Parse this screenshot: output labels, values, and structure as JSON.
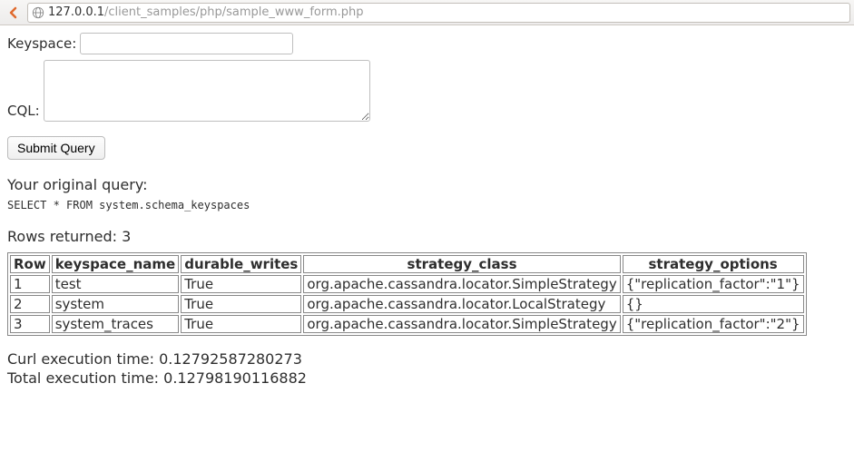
{
  "url": {
    "host": "127.0.0.1",
    "path": "/client_samples/php/sample_www_form.php"
  },
  "form": {
    "keyspace_label": "Keyspace:",
    "keyspace_value": "",
    "cql_label": "CQL:",
    "cql_value": "",
    "submit_label": "Submit Query"
  },
  "original_query_label": "Your original query:",
  "original_query": "SELECT * FROM system.schema_keyspaces",
  "rows_returned_label": "Rows returned: ",
  "rows_returned_count": "3",
  "table": {
    "headers": [
      "Row",
      "keyspace_name",
      "durable_writes",
      "strategy_class",
      "strategy_options"
    ],
    "rows": [
      [
        "1",
        "test",
        "True",
        "org.apache.cassandra.locator.SimpleStrategy",
        "{\"replication_factor\":\"1\"}"
      ],
      [
        "2",
        "system",
        "True",
        "org.apache.cassandra.locator.LocalStrategy",
        "{}"
      ],
      [
        "3",
        "system_traces",
        "True",
        "org.apache.cassandra.locator.SimpleStrategy",
        "{\"replication_factor\":\"2\"}"
      ]
    ]
  },
  "timing": {
    "curl_label": "Curl execution time: ",
    "curl_value": "0.12792587280273",
    "total_label": "Total execution time: ",
    "total_value": "0.12798190116882"
  }
}
